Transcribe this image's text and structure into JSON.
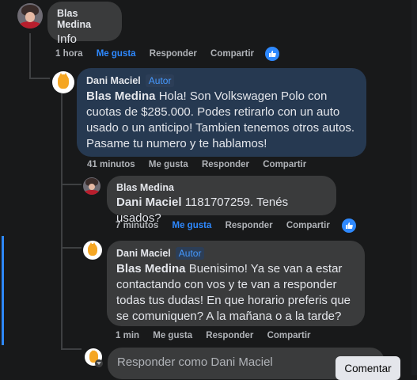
{
  "comments": [
    {
      "author": "Blas Medina",
      "badge": "",
      "mention": "",
      "text": "Info",
      "actions": {
        "time": "1 hora",
        "like": "Me gusta",
        "reply": "Responder",
        "share": "Compartir"
      },
      "like_liked": true
    },
    {
      "author": "Dani Maciel",
      "badge": "Autor",
      "mention": "Blas Medina",
      "text": " Hola! Son Volkswagen Polo con cuotas de $285.000. Podes retirarlo con un auto usado o un anticipo! Tambien tenemos otros autos. Pasame tu numero y te hablamos!",
      "actions": {
        "time": "41 minutos",
        "like": "Me gusta",
        "reply": "Responder",
        "share": "Compartir"
      },
      "like_liked": false
    },
    {
      "author": "Blas Medina",
      "badge": "",
      "mention": "Dani Maciel",
      "text": " 1181707259. Tenés usados?",
      "actions": {
        "time": "7 minutos",
        "like": "Me gusta",
        "reply": "Responder",
        "share": "Compartir"
      },
      "like_liked": true
    },
    {
      "author": "Dani Maciel",
      "badge": "Autor",
      "mention": "Blas Medina",
      "text": " Buenisimo! Ya se van a estar contactando con vos y te van a responder todas tus dudas! En que horario preferis que se comuniquen? A la mañana o a la tarde?",
      "actions": {
        "time": "1 min",
        "like": "Me gusta",
        "reply": "Responder",
        "share": "Compartir"
      },
      "like_liked": false
    }
  ],
  "reply_box": {
    "placeholder": "Responder como Dani Maciel"
  },
  "comment_button": "Comentar",
  "colors": {
    "accent": "#2e89ff",
    "bubble_grey": "#3a3b3c",
    "bubble_blue": "#263951"
  }
}
